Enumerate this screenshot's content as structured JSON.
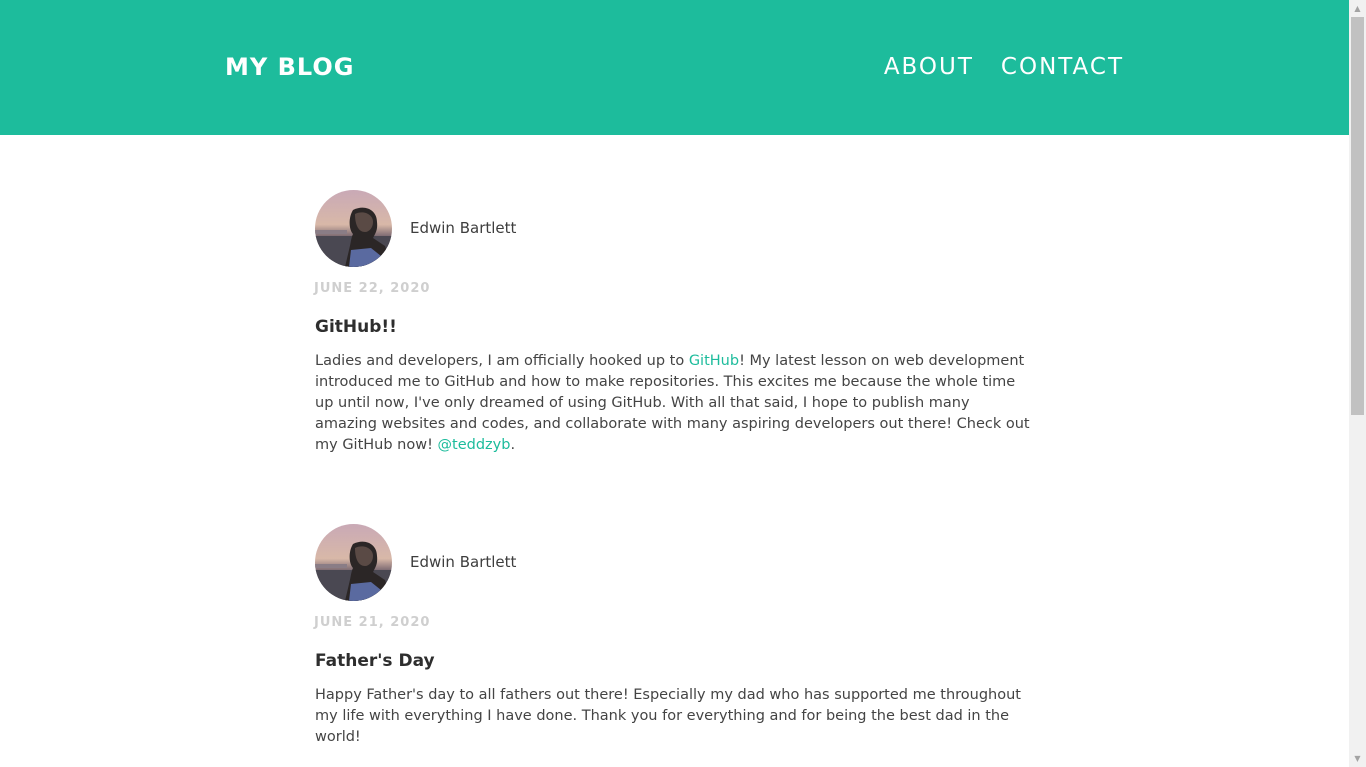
{
  "header": {
    "brand": "MY BLOG",
    "nav": [
      {
        "label": "ABOUT"
      },
      {
        "label": "CONTACT"
      }
    ]
  },
  "posts": [
    {
      "author": "Edwin Bartlett",
      "date": "JUNE 22, 2020",
      "title": "GitHub!!",
      "body": {
        "p1": "Ladies and developers, I am officially hooked up to ",
        "link1": "GitHub",
        "p2": "! My latest lesson on web development introduced me to GitHub and how to make repositories. This excites me because the whole time up until now, I've only dreamed of using GitHub. With all that said, I hope to publish many amazing websites and codes, and collaborate with many aspiring developers out there! Check out my GitHub now! ",
        "link2": "@teddzyb",
        "p3": "."
      }
    },
    {
      "author": "Edwin Bartlett",
      "date": "JUNE 21, 2020",
      "title": "Father's Day",
      "body": {
        "p1": "Happy Father's day to all fathers out there! Especially my dad who has supported me throughout my life with everything I have done. Thank you for everything and for being the best dad in the world!"
      }
    }
  ],
  "colors": {
    "accent": "#1dbc9c",
    "date": "#cfcfcf"
  },
  "icons": [
    "scroll-up-arrow-icon",
    "scroll-down-arrow-icon"
  ]
}
